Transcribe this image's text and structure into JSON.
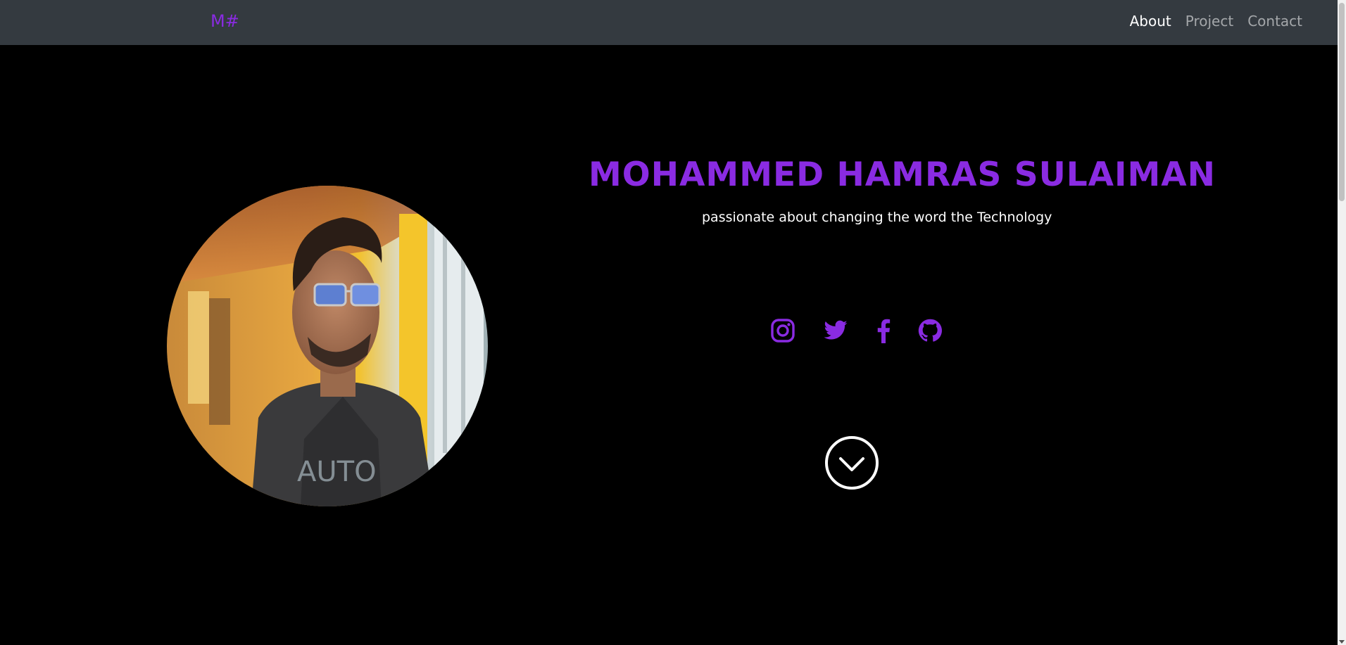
{
  "navbar": {
    "brand": "M#",
    "links": [
      {
        "label": "About",
        "active": true
      },
      {
        "label": "Project",
        "active": false
      },
      {
        "label": "Contact",
        "active": false
      }
    ]
  },
  "hero": {
    "name": "MOHAMMED HAMRAS SULAIMAN",
    "tagline": "passionate about changing the word the Technology",
    "photo_alt": "profile-photo"
  },
  "social": [
    {
      "icon": "instagram-icon"
    },
    {
      "icon": "twitter-icon"
    },
    {
      "icon": "facebook-icon"
    },
    {
      "icon": "github-icon"
    }
  ],
  "scroll_button": {
    "icon": "chevron-down-icon"
  },
  "colors": {
    "accent": "#8a2be2",
    "navbar": "#343a40",
    "background": "#000000",
    "text": "#ffffff"
  }
}
